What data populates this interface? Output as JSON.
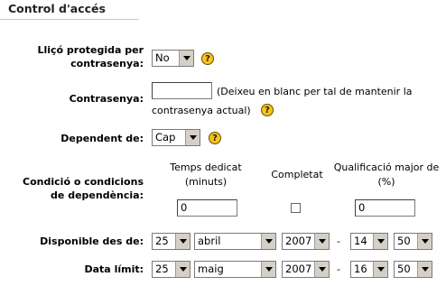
{
  "section": {
    "title": "Control d'accés"
  },
  "password_protected": {
    "label_line1": "Lliçó protegida per",
    "label_line2": "contrasenya:",
    "value": "No",
    "help_icon": "help-icon"
  },
  "password": {
    "label": "Contrasenya:",
    "value": "",
    "hint_line1": "(Deixeu en blanc per tal de mantenir la",
    "hint_line2": "contrasenya actual)"
  },
  "dependent": {
    "label": "Dependent de:",
    "value": "Cap"
  },
  "conditions": {
    "label_line1": "Condició o condicions",
    "label_line2": "de dependència:",
    "time_header_line1": "Temps dedicat",
    "time_header_line2": "(minuts)",
    "completed_header": "Completat",
    "grade_header_line1": "Qualificació major de",
    "grade_header_line2": "(%)",
    "time_value": "0",
    "completed_checked": false,
    "grade_value": "0"
  },
  "available_from": {
    "label": "Disponible des de:",
    "day": "25",
    "month": "abril",
    "year": "2007",
    "sep": "-",
    "hour": "14",
    "minute": "50"
  },
  "deadline": {
    "label": "Data límit:",
    "day": "25",
    "month": "maig",
    "year": "2007",
    "sep": "-",
    "hour": "16",
    "minute": "50"
  }
}
